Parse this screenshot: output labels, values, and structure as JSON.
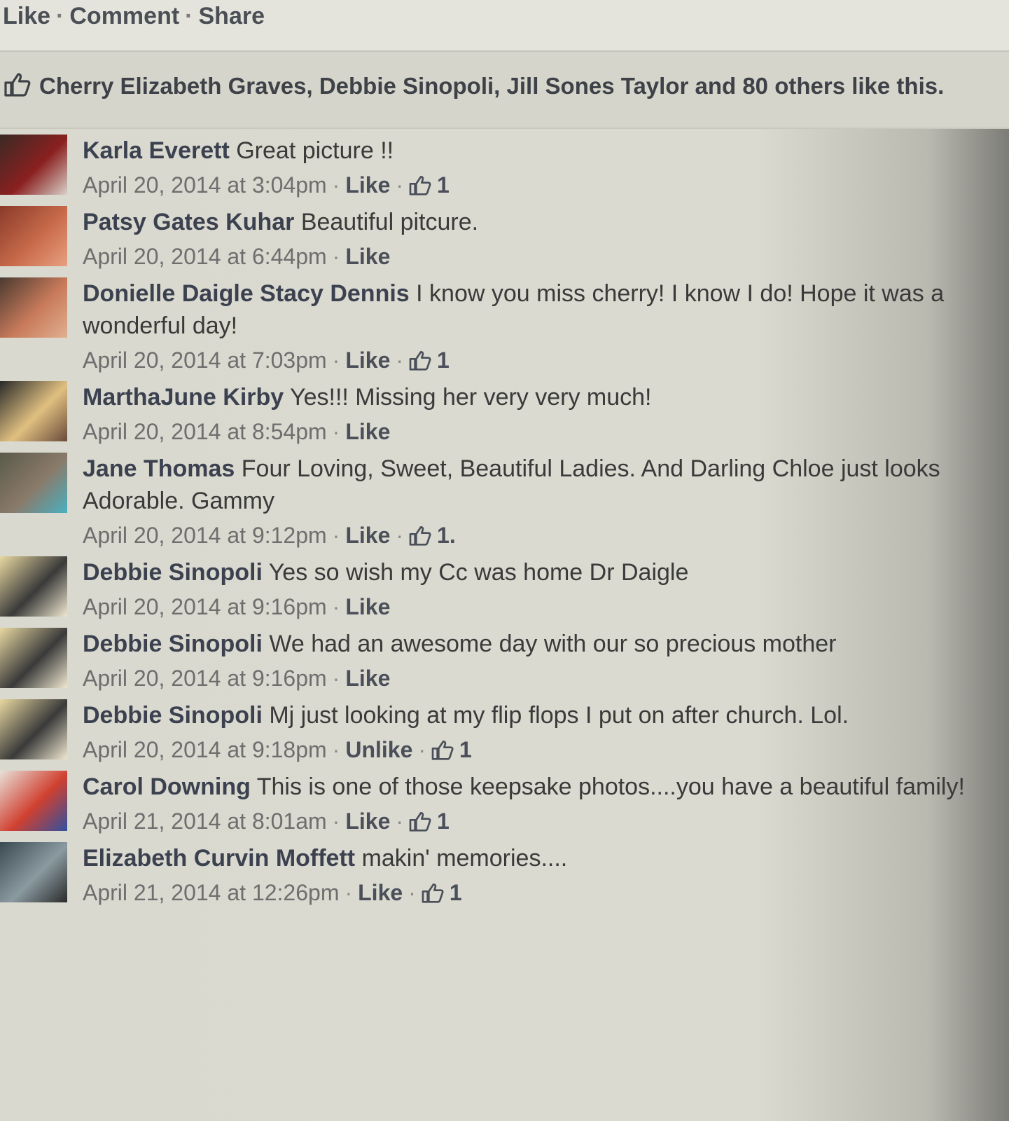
{
  "actions": {
    "like": "Like",
    "comment": "Comment",
    "share": "Share",
    "separator": "·"
  },
  "likes_summary": {
    "icon": "thumbs-up-icon",
    "text": "Cherry Elizabeth Graves, Debbie Sinopoli, Jill Sones Taylor and 80 others like this."
  },
  "comments": [
    {
      "author": "Karla Everett",
      "text": "Great picture !!",
      "timestamp": "April 20, 2014 at 3:04pm",
      "like_label": "Like",
      "like_count": "1"
    },
    {
      "author": "Patsy Gates Kuhar",
      "text": "Beautiful pitcure.",
      "timestamp": "April 20, 2014 at 6:44pm",
      "like_label": "Like",
      "like_count": ""
    },
    {
      "author": "Donielle Daigle Stacy Dennis",
      "text": "I know you miss cherry! I know I do! Hope it was a wonderful day!",
      "timestamp": "April 20, 2014 at 7:03pm",
      "like_label": "Like",
      "like_count": "1"
    },
    {
      "author": "MarthaJune Kirby",
      "text": "Yes!!! Missing her very very much!",
      "timestamp": "April 20, 2014 at 8:54pm",
      "like_label": "Like",
      "like_count": ""
    },
    {
      "author": "Jane Thomas",
      "text": "Four Loving, Sweet, Beautiful Ladies. And Darling Chloe just looks Adorable. Gammy",
      "timestamp": "April 20, 2014 at 9:12pm",
      "like_label": "Like",
      "like_count": "1."
    },
    {
      "author": "Debbie Sinopoli",
      "text": "Yes so wish my Cc was home Dr Daigle",
      "timestamp": "April 20, 2014 at 9:16pm",
      "like_label": "Like",
      "like_count": ""
    },
    {
      "author": "Debbie Sinopoli",
      "text": "We had an awesome day with our so precious mother",
      "timestamp": "April 20, 2014 at 9:16pm",
      "like_label": "Like",
      "like_count": ""
    },
    {
      "author": "Debbie Sinopoli",
      "text": "Mj just looking at my flip flops I put on after church. Lol.",
      "timestamp": "April 20, 2014 at 9:18pm",
      "like_label": "Unlike",
      "like_count": "1"
    },
    {
      "author": "Carol Downing",
      "text": "This is one of those keepsake photos....you have a beautiful family!",
      "timestamp": "April 21, 2014 at 8:01am",
      "like_label": "Like",
      "like_count": "1"
    },
    {
      "author": "Elizabeth Curvin Moffett",
      "text": "makin' memories....",
      "timestamp": "April 21, 2014 at 12:26pm",
      "like_label": "Like",
      "like_count": "1"
    }
  ],
  "colors": {
    "background": "#dcdcd2",
    "author": "#3c4150",
    "meta": "#6e6e6e"
  }
}
